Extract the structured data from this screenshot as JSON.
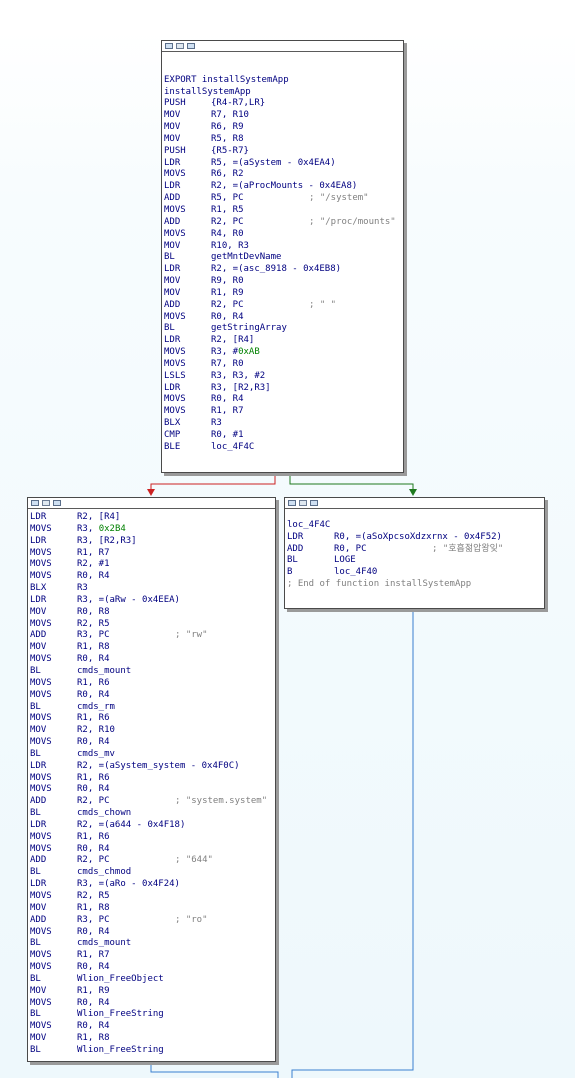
{
  "colors": {
    "instr": "#000080",
    "number": "#008000",
    "comment": "#808080",
    "edge_false": "#cc2222",
    "edge_true": "#1f7a1f",
    "edge_normal": "#3a7fd0"
  },
  "header_icons": [
    "graph-view-icon",
    "flow-icon",
    "text-view-icon"
  ],
  "block1": {
    "lines": [
      {
        "t": "blank"
      },
      {
        "t": "blank"
      },
      {
        "t": "label",
        "text": "EXPORT installSystemApp"
      },
      {
        "t": "label",
        "text": "installSystemApp"
      },
      {
        "t": "ins",
        "mn": "PUSH",
        "op": "{R4-R7,LR}"
      },
      {
        "t": "ins",
        "mn": "MOV",
        "op": "R7, R10"
      },
      {
        "t": "ins",
        "mn": "MOV",
        "op": "R6, R9"
      },
      {
        "t": "ins",
        "mn": "MOV",
        "op": "R5, R8"
      },
      {
        "t": "ins",
        "mn": "PUSH",
        "op": "{R5-R7}"
      },
      {
        "t": "ins",
        "mn": "LDR",
        "op": "R5, =(aSystem - 0x4EA4)"
      },
      {
        "t": "ins",
        "mn": "MOVS",
        "op": "R6, R2"
      },
      {
        "t": "ins",
        "mn": "LDR",
        "op": "R2, =(aProcMounts - 0x4EA8)"
      },
      {
        "t": "ins",
        "mn": "ADD",
        "op": "R5, PC",
        "cm": "; \"/system\""
      },
      {
        "t": "ins",
        "mn": "MOVS",
        "op": "R1, R5"
      },
      {
        "t": "ins",
        "mn": "ADD",
        "op": "R2, PC",
        "cm": "; \"/proc/mounts\""
      },
      {
        "t": "ins",
        "mn": "MOVS",
        "op": "R4, R0"
      },
      {
        "t": "ins",
        "mn": "MOV",
        "op": "R10, R3"
      },
      {
        "t": "ins",
        "mn": "BL",
        "op": "getMntDevName"
      },
      {
        "t": "ins",
        "mn": "LDR",
        "op": "R2, =(asc_8918 - 0x4EB8)"
      },
      {
        "t": "ins",
        "mn": "MOV",
        "op": "R9, R0"
      },
      {
        "t": "ins",
        "mn": "MOV",
        "op": "R1, R9"
      },
      {
        "t": "ins",
        "mn": "ADD",
        "op": "R2, PC",
        "cm": "; \" \""
      },
      {
        "t": "ins",
        "mn": "MOVS",
        "op": "R0, R4"
      },
      {
        "t": "ins",
        "mn": "BL",
        "op": "getStringArray"
      },
      {
        "t": "ins",
        "mn": "LDR",
        "op": "R2, [R4]"
      },
      {
        "t": "ins",
        "mn": "MOVS",
        "op": "R3, #",
        "num": "0xAB"
      },
      {
        "t": "ins",
        "mn": "MOVS",
        "op": "R7, R0"
      },
      {
        "t": "ins",
        "mn": "LSLS",
        "op": "R3, R3, #2"
      },
      {
        "t": "ins",
        "mn": "LDR",
        "op": "R3, [R2,R3]"
      },
      {
        "t": "ins",
        "mn": "MOVS",
        "op": "R0, R4"
      },
      {
        "t": "ins",
        "mn": "MOVS",
        "op": "R1, R7"
      },
      {
        "t": "ins",
        "mn": "BLX",
        "op": "R3"
      },
      {
        "t": "ins",
        "mn": "CMP",
        "op": "R0, #1"
      },
      {
        "t": "ins",
        "mn": "BLE",
        "op": "loc_4F4C"
      }
    ]
  },
  "block2": {
    "lines": [
      {
        "t": "ins",
        "mn": "LDR",
        "op": "R2, [R4]"
      },
      {
        "t": "ins",
        "mn": "MOVS",
        "op": "R3, ",
        "num": "0x2B4"
      },
      {
        "t": "ins",
        "mn": "LDR",
        "op": "R3, [R2,R3]"
      },
      {
        "t": "ins",
        "mn": "MOVS",
        "op": "R1, R7"
      },
      {
        "t": "ins",
        "mn": "MOVS",
        "op": "R2, #1"
      },
      {
        "t": "ins",
        "mn": "MOVS",
        "op": "R0, R4"
      },
      {
        "t": "ins",
        "mn": "BLX",
        "op": "R3"
      },
      {
        "t": "ins",
        "mn": "LDR",
        "op": "R3, =(aRw - 0x4EEA)"
      },
      {
        "t": "ins",
        "mn": "MOV",
        "op": "R0, R8"
      },
      {
        "t": "ins",
        "mn": "MOVS",
        "op": "R2, R5"
      },
      {
        "t": "ins",
        "mn": "ADD",
        "op": "R3, PC",
        "cm": "; \"rw\""
      },
      {
        "t": "ins",
        "mn": "MOV",
        "op": "R1, R8"
      },
      {
        "t": "ins",
        "mn": "MOVS",
        "op": "R0, R4"
      },
      {
        "t": "ins",
        "mn": "BL",
        "op": "cmds_mount"
      },
      {
        "t": "ins",
        "mn": "MOVS",
        "op": "R1, R6"
      },
      {
        "t": "ins",
        "mn": "MOVS",
        "op": "R0, R4"
      },
      {
        "t": "ins",
        "mn": "BL",
        "op": "cmds_rm"
      },
      {
        "t": "ins",
        "mn": "MOVS",
        "op": "R1, R6"
      },
      {
        "t": "ins",
        "mn": "MOV",
        "op": "R2, R10"
      },
      {
        "t": "ins",
        "mn": "MOVS",
        "op": "R0, R4"
      },
      {
        "t": "ins",
        "mn": "BL",
        "op": "cmds_mv"
      },
      {
        "t": "ins",
        "mn": "LDR",
        "op": "R2, =(aSystem_system - 0x4F0C)"
      },
      {
        "t": "ins",
        "mn": "MOVS",
        "op": "R1, R6"
      },
      {
        "t": "ins",
        "mn": "MOVS",
        "op": "R0, R4"
      },
      {
        "t": "ins",
        "mn": "ADD",
        "op": "R2, PC",
        "cm": "; \"system.system\""
      },
      {
        "t": "ins",
        "mn": "BL",
        "op": "cmds_chown"
      },
      {
        "t": "ins",
        "mn": "LDR",
        "op": "R2, =(a644 - 0x4F18)"
      },
      {
        "t": "ins",
        "mn": "MOVS",
        "op": "R1, R6"
      },
      {
        "t": "ins",
        "mn": "MOVS",
        "op": "R0, R4"
      },
      {
        "t": "ins",
        "mn": "ADD",
        "op": "R2, PC",
        "cm": "; \"644\""
      },
      {
        "t": "ins",
        "mn": "BL",
        "op": "cmds_chmod"
      },
      {
        "t": "ins",
        "mn": "LDR",
        "op": "R3, =(aRo - 0x4F24)"
      },
      {
        "t": "ins",
        "mn": "MOVS",
        "op": "R2, R5"
      },
      {
        "t": "ins",
        "mn": "MOV",
        "op": "R1, R8"
      },
      {
        "t": "ins",
        "mn": "ADD",
        "op": "R3, PC",
        "cm": "; \"ro\""
      },
      {
        "t": "ins",
        "mn": "MOVS",
        "op": "R0, R4"
      },
      {
        "t": "ins",
        "mn": "BL",
        "op": "cmds_mount"
      },
      {
        "t": "ins",
        "mn": "MOVS",
        "op": "R1, R7"
      },
      {
        "t": "ins",
        "mn": "MOVS",
        "op": "R0, R4"
      },
      {
        "t": "ins",
        "mn": "BL",
        "op": "Wlion_FreeObject"
      },
      {
        "t": "ins",
        "mn": "MOV",
        "op": "R1, R9"
      },
      {
        "t": "ins",
        "mn": "MOVS",
        "op": "R0, R4"
      },
      {
        "t": "ins",
        "mn": "BL",
        "op": "Wlion_FreeString"
      },
      {
        "t": "ins",
        "mn": "MOVS",
        "op": "R0, R4"
      },
      {
        "t": "ins",
        "mn": "MOV",
        "op": "R1, R8"
      },
      {
        "t": "ins",
        "mn": "BL",
        "op": "Wlion_FreeString"
      }
    ]
  },
  "block3": {
    "lines": [
      {
        "t": "blank"
      },
      {
        "t": "label",
        "text": "loc_4F4C"
      },
      {
        "t": "ins",
        "mn": "LDR",
        "op": "R0, =(aSoXpcsoXdzxrnx - 0x4F52)"
      },
      {
        "t": "ins",
        "mn": "ADD",
        "op": "R0, PC",
        "cm": "; \"호흡젊압왕잊\""
      },
      {
        "t": "ins",
        "mn": "BL",
        "op": "LOGE"
      },
      {
        "t": "ins",
        "mn": "B",
        "op": "loc_4F40"
      },
      {
        "t": "comment",
        "text": "; End of function installSystemApp"
      }
    ]
  }
}
